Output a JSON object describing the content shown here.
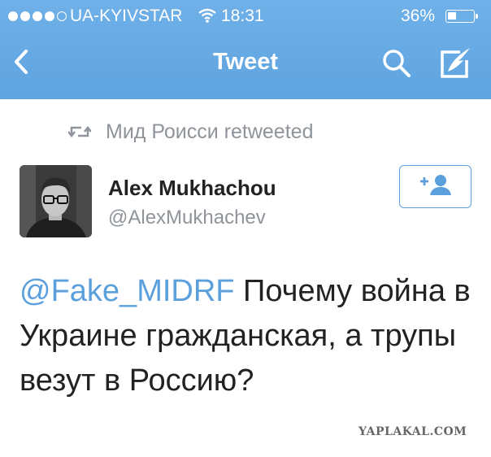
{
  "status_bar": {
    "carrier": "UA-KYIVSTAR",
    "time": "18:31",
    "battery_percent": "36%",
    "battery_level": 0.36,
    "signal_bars": 4,
    "signal_total": 5
  },
  "nav": {
    "title": "Tweet",
    "back_icon": "chevron-left-icon",
    "search_icon": "search-icon",
    "compose_icon": "compose-icon",
    "color": "#63a8e4"
  },
  "retweet": {
    "icon": "retweet-icon",
    "text": "Мид Роисси retweeted"
  },
  "tweet": {
    "author_name": "Alex Mukhachou",
    "author_handle": "@AlexMukhachev",
    "mention": "@Fake_MIDRF",
    "text_rest": " Почему война в Украине гражданская, а трупы везут в Россию?",
    "follow_icon": "add-user-icon"
  },
  "watermark": "YAPLAKAL.COM"
}
